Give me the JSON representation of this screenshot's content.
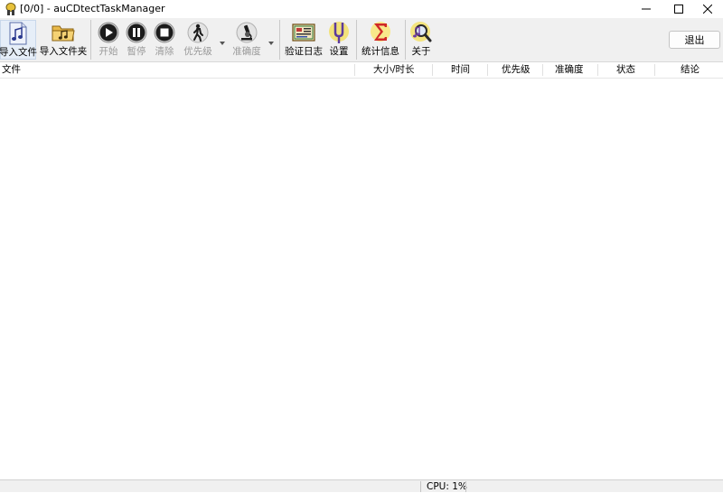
{
  "window": {
    "title": "[0/0] - auCDtectTaskManager"
  },
  "toolbar": {
    "import_file": "导入文件",
    "import_folder": "导入文件夹",
    "start": "开始",
    "pause": "暂停",
    "clear": "清除",
    "priority": "优先级",
    "accuracy": "准确度",
    "verify_log": "验证日志",
    "settings": "设置",
    "statistics": "统计信息",
    "about": "关于",
    "exit": "退出"
  },
  "list": {
    "columns": [
      "文件",
      "大小/时长",
      "时间",
      "优先级",
      "准确度",
      "状态",
      "结论"
    ],
    "rows": []
  },
  "status": {
    "cpu": "CPU: 1%"
  }
}
